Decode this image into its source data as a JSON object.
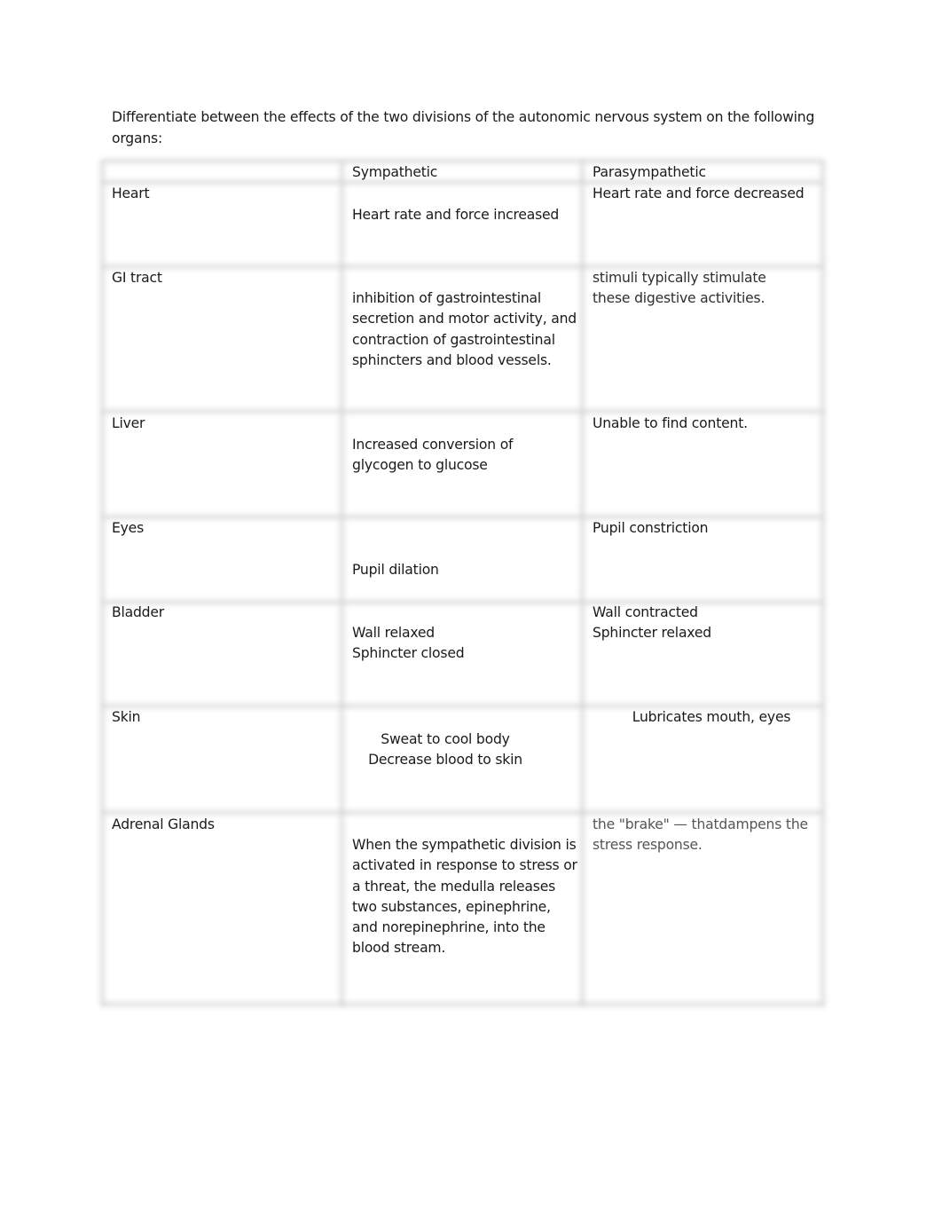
{
  "document": {
    "prompt": "Differentiate between the effects of the two divisions of the autonomic nervous system on the following organs:",
    "table": {
      "headers": [
        "",
        "Sympathetic",
        "Parasympathetic"
      ],
      "rows": [
        {
          "organ": "Heart",
          "sympathetic": "Heart rate and force increased",
          "parasympathetic": "Heart rate and force decreased"
        },
        {
          "organ": "GI tract",
          "sympathetic": "inhibition of gastrointestinal secretion and motor activity, and contraction of gastrointestinal sphincters and blood vessels.",
          "parasympathetic": "stimuli typically stimulate these digestive activities."
        },
        {
          "organ": "Liver",
          "sympathetic": "Increased conversion of glycogen to glucose",
          "parasympathetic": "Unable to find content."
        },
        {
          "organ": "Eyes",
          "sympathetic": "Pupil dilation",
          "parasympathetic": "Pupil constriction"
        },
        {
          "organ": "Bladder",
          "sympathetic": "Wall relaxed\nSphincter closed",
          "parasympathetic": "Wall contracted\nSphincter relaxed"
        },
        {
          "organ": "Skin",
          "sympathetic": "Sweat to cool body\nDecrease blood to skin",
          "parasympathetic": "Lubricates mouth, eyes"
        },
        {
          "organ": "Adrenal Glands",
          "sympathetic": "When the sympathetic division is activated in response to stress or a threat, the medulla releases two substances, epinephrine, and norepinephrine, into the blood stream.",
          "parasympathetic": "the \"brake\" — thatdampens the stress response."
        }
      ]
    }
  }
}
